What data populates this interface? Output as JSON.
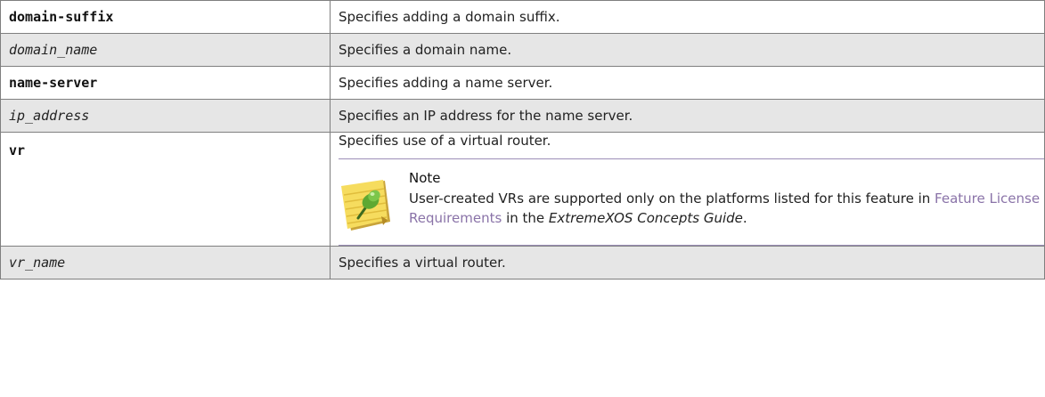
{
  "rows": [
    {
      "param": "domain-suffix",
      "desc": "Specifies adding a domain suffix."
    },
    {
      "param": "domain_name",
      "desc": "Specifies a domain name."
    },
    {
      "param": "name-server",
      "desc": "Specifies adding a name server."
    },
    {
      "param": "ip_address",
      "desc": "Specifies an IP address for the name server."
    },
    {
      "param": "vr",
      "desc": "Specifies use of a virtual router."
    },
    {
      "param": "vr_name",
      "desc": "Specifies a virtual router."
    }
  ],
  "note": {
    "title": "Note",
    "text_1": "User-created VRs are supported only on the platforms listed for this feature in ",
    "link": "Feature License Requirements",
    "text_2": " in the ",
    "guide": "ExtremeXOS Concepts Guide",
    "text_3": "."
  },
  "colors": {
    "shade": "#e6e6e6",
    "link": "#8a73a8",
    "rule": "#9c8fb8",
    "border": "#7f7f7f"
  },
  "icons": [
    "note-pad-pushpin-icon"
  ]
}
